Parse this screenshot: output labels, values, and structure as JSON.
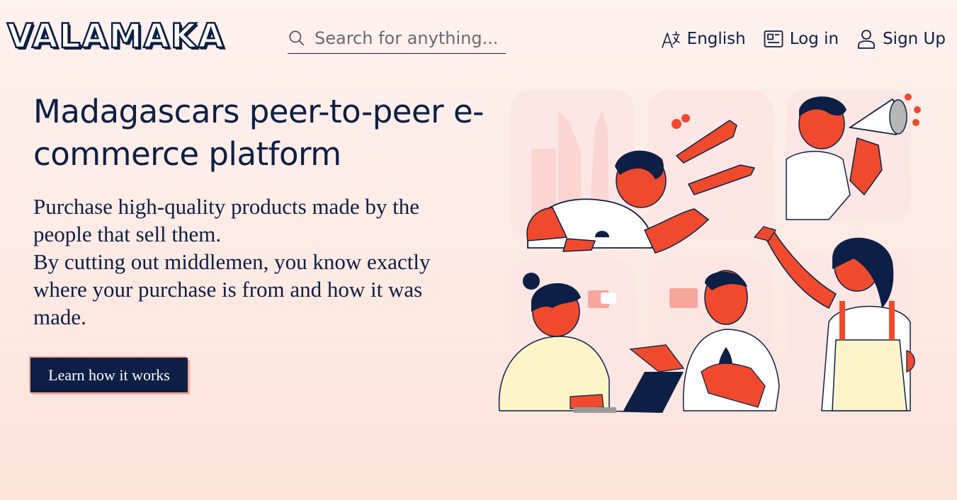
{
  "brand": {
    "logo_text": "VALAMAKA"
  },
  "search": {
    "placeholder": "Search for anything..."
  },
  "nav": {
    "language_label": "English",
    "login_label": "Log in",
    "signup_label": "Sign Up"
  },
  "hero": {
    "title": "Madagascars peer-to-peer e-commerce platform",
    "paragraph_1": "Purchase high-quality products made by the people that sell them.",
    "paragraph_2": "By cutting out middlemen, you know exactly where your purchase is from and how it was made.",
    "cta_label": "Learn how it works"
  },
  "colors": {
    "navy": "#0c1f45",
    "accent_red": "#f04a2c",
    "cta_border": "#f6a69a",
    "background_top": "#fff2ef",
    "background_bottom": "#fde3da"
  },
  "icons": {
    "search": "search-icon",
    "language": "translate-icon",
    "login": "login-card-icon",
    "signup": "user-icon"
  }
}
